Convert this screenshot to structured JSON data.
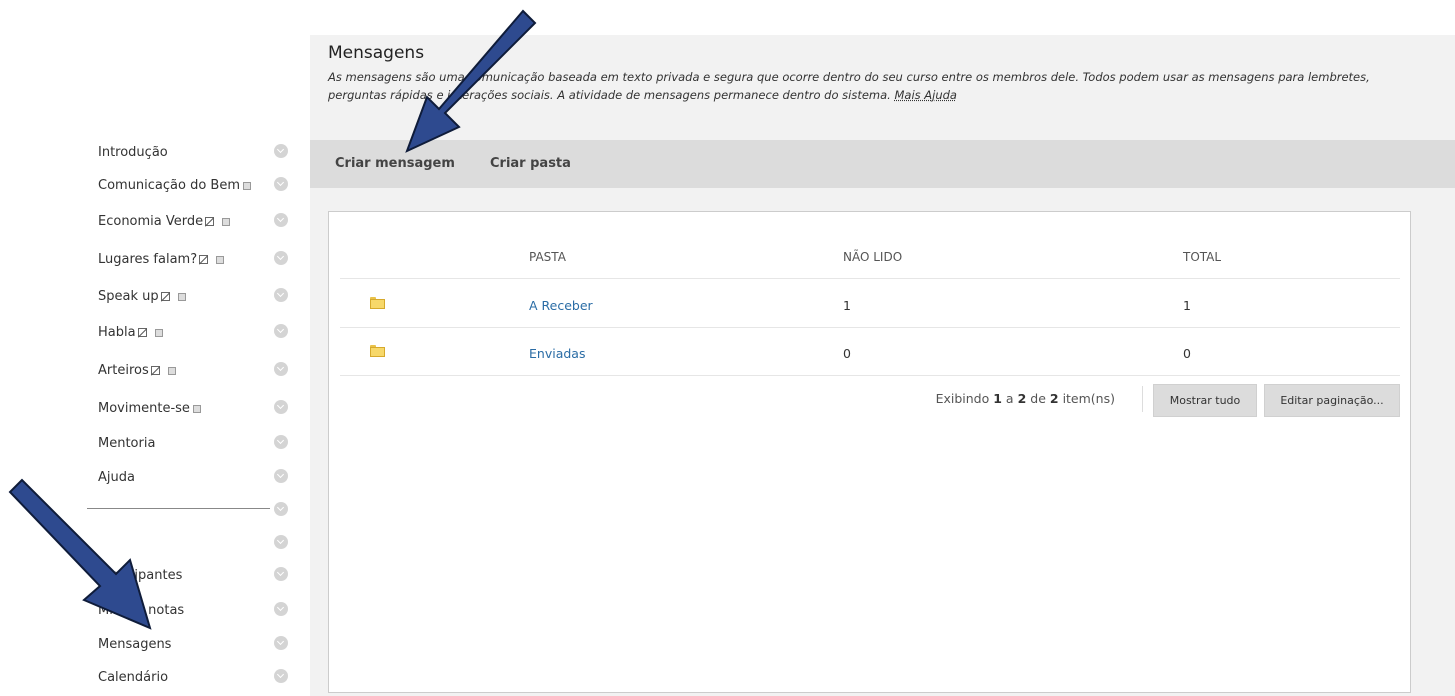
{
  "sidebar": {
    "items": [
      {
        "label": "Introdução",
        "marks": ""
      },
      {
        "label": "Comunicação do Bem",
        "marks": "cal"
      },
      {
        "label": "Economia Verde",
        "marks": "hide-cal"
      },
      {
        "label": "Lugares falam?",
        "marks": "hide-cal"
      },
      {
        "label": "Speak up",
        "marks": "hide-cal"
      },
      {
        "label": "Habla",
        "marks": "hide-cal"
      },
      {
        "label": "Arteiros",
        "marks": "hide-cal"
      },
      {
        "label": "Movimente-se",
        "marks": "cal"
      },
      {
        "label": "Mentoria",
        "marks": ""
      },
      {
        "label": "Ajuda",
        "marks": ""
      }
    ],
    "tools": [
      {
        "label": "Participantes"
      },
      {
        "label": "Minhas notas"
      },
      {
        "label": "Mensagens"
      },
      {
        "label": "Calendário"
      }
    ]
  },
  "main": {
    "title": "Mensagens",
    "description": "As mensagens são uma comunicação baseada em texto privada e segura que ocorre dentro do seu curso entre os membros dele. Todos podem usar as mensagens para lembretes, perguntas rápidas e interações sociais. A atividade de mensagens permanece dentro do sistema.",
    "help_link": "Mais Ajuda",
    "actions": {
      "create_message": "Criar mensagem",
      "create_folder": "Criar pasta"
    }
  },
  "table": {
    "headers": {
      "folder": "PASTA",
      "unread": "NÃO LIDO",
      "total": "TOTAL"
    },
    "rows": [
      {
        "name": "A Receber",
        "unread": "1",
        "total": "1"
      },
      {
        "name": "Enviadas",
        "unread": "0",
        "total": "0"
      }
    ]
  },
  "pagination": {
    "prefix": "Exibindo",
    "from": "1",
    "sep1": "a",
    "to": "2",
    "sep2": "de",
    "count": "2",
    "suffix": "item(ns)",
    "show_all": "Mostrar tudo",
    "edit": "Editar paginação..."
  },
  "colors": {
    "arrow": "#2e4a8f",
    "link": "#2a6ca5",
    "action_bar": "#dcdcdc"
  },
  "icons": {
    "folder": "folder-icon",
    "chevron": "chevron-down-icon",
    "arrow": "pointer-arrow-icon"
  }
}
